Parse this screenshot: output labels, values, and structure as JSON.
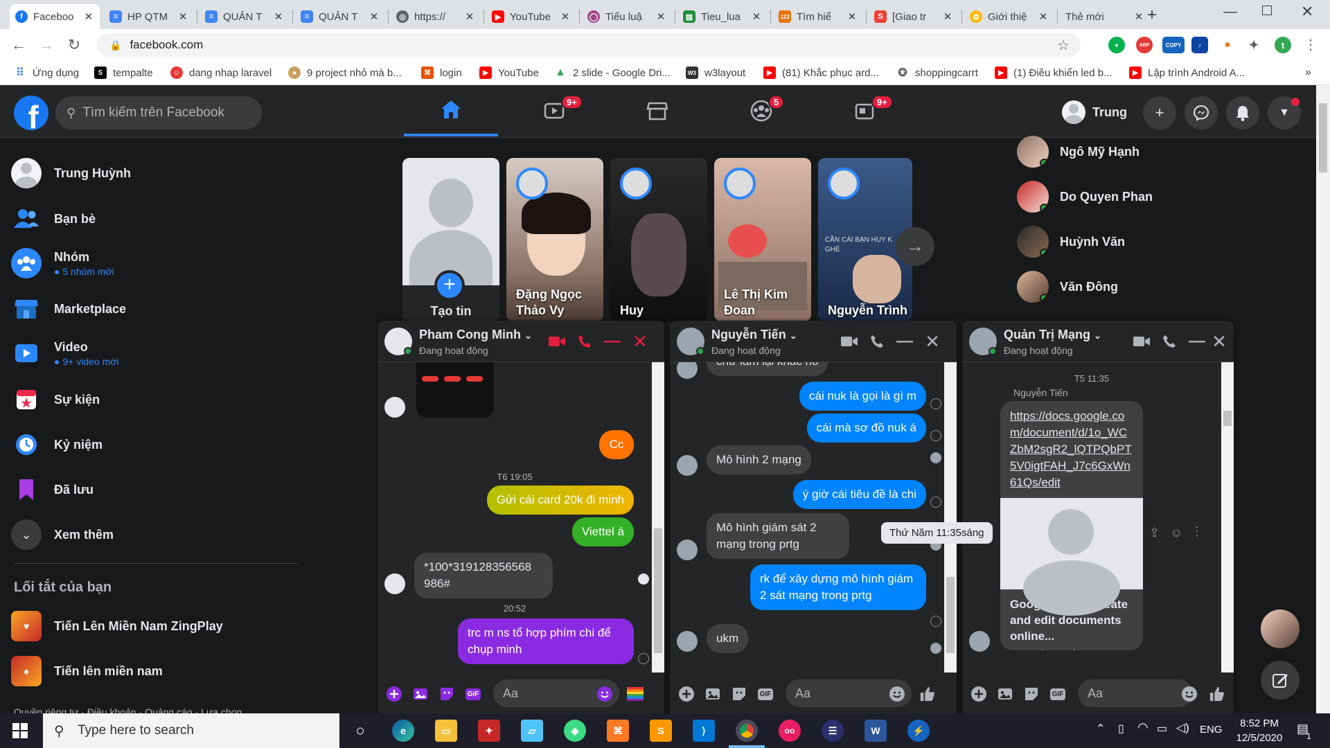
{
  "browser": {
    "tabs": [
      {
        "label": "Faceboo",
        "color": "#1877f2",
        "glyph": "f"
      },
      {
        "label": "HP QTM",
        "color": "#4285f4",
        "glyph": "≡"
      },
      {
        "label": "QUẢN T",
        "color": "#4285f4",
        "glyph": "≡"
      },
      {
        "label": "QUẢN T",
        "color": "#4285f4",
        "glyph": "≡"
      },
      {
        "label": "https://",
        "color": "#5f6368",
        "glyph": "◎"
      },
      {
        "label": "YouTube",
        "color": "#ff0000",
        "glyph": "▶"
      },
      {
        "label": "Tiểu luậ",
        "color": "#a0478a",
        "glyph": "◯"
      },
      {
        "label": "Tieu_lua",
        "color": "#1e8e3e",
        "glyph": "▤"
      },
      {
        "label": "Tìm hiể",
        "color": "#e8710a",
        "glyph": "123"
      },
      {
        "label": "[Giao tr",
        "color": "#ea4335",
        "glyph": "S"
      },
      {
        "label": "Giới thiệ",
        "color": "#fbbc04",
        "glyph": "✿"
      },
      {
        "label": "Thẻ mới",
        "color": "",
        "glyph": ""
      }
    ],
    "url": "facebook.com",
    "bookmarks": [
      {
        "label": "Ứng dụng",
        "color": "#4285f4",
        "glyph": "⠿"
      },
      {
        "label": "tempalte",
        "color": "#000000",
        "glyph": "S"
      },
      {
        "label": "dang nhap laravel",
        "color": "#e53935",
        "glyph": "☺"
      },
      {
        "label": "9 project nhỏ mà b...",
        "color": "#c8a060",
        "glyph": "●"
      },
      {
        "label": "login",
        "color": "#e65100",
        "glyph": "⌘"
      },
      {
        "label": "YouTube",
        "color": "#ff0000",
        "glyph": "▶"
      },
      {
        "label": "2 slide - Google Dri...",
        "color": "#34a853",
        "glyph": "▲"
      },
      {
        "label": "w3layout",
        "color": "#333333",
        "glyph": "W3"
      },
      {
        "label": "(81) Khắc phục ard...",
        "color": "#ff0000",
        "glyph": "▶"
      },
      {
        "label": "shoppingcarrt",
        "color": "#666666",
        "glyph": "✪"
      },
      {
        "label": "(1) Điều khiển led b...",
        "color": "#ff0000",
        "glyph": "▶"
      },
      {
        "label": "Lập trình Android A...",
        "color": "#ff0000",
        "glyph": "▶"
      }
    ],
    "ext_copy": "COPY",
    "ext_abp": "ABP",
    "profile_initial": "t"
  },
  "fb": {
    "search_placeholder": "Tìm kiếm trên Facebook",
    "badges": {
      "watch": "9+",
      "groups": "5",
      "gaming": "9+"
    },
    "user_name": "Trung",
    "sidebar": [
      {
        "label": "Trung Huỳnh",
        "sub": ""
      },
      {
        "label": "Bạn bè",
        "sub": ""
      },
      {
        "label": "Nhóm",
        "sub": "5 nhóm mới"
      },
      {
        "label": "Marketplace",
        "sub": ""
      },
      {
        "label": "Video",
        "sub": "9+ video mới"
      },
      {
        "label": "Sự kiện",
        "sub": ""
      },
      {
        "label": "Kỷ niệm",
        "sub": ""
      },
      {
        "label": "Đã lưu",
        "sub": ""
      },
      {
        "label": "Xem thêm",
        "sub": ""
      }
    ],
    "shortcuts_title": "Lối tắt của bạn",
    "shortcuts": [
      "Tiến Lên Miền Nam ZingPlay",
      "Tiến lên miền nam"
    ],
    "footer": "Quyền riêng tư · Điều khoản · Quảng cáo · Lựa chọn",
    "stories": [
      {
        "name": "Tạo tin"
      },
      {
        "name": "Đặng Ngọc Thảo Vy"
      },
      {
        "name": "Huy"
      },
      {
        "name": "Lê Thị Kim Đoan"
      },
      {
        "name": "Nguyễn Trình"
      }
    ],
    "story_overlay_text": "CẦN CÁI BẠN HUY K GHÉ",
    "contacts": [
      "Ngô Mỹ Hạnh",
      "Do Quyen Phan",
      "Huỳnh Văn",
      "Văn Đông"
    ]
  },
  "chats": [
    {
      "name": "Pham Cong Minh",
      "status": "Đang hoạt động",
      "messages": [
        {
          "text": "Cc",
          "dir": "out"
        },
        {
          "text": "T6 19:05",
          "dir": "time"
        },
        {
          "text": "Gửi cái card 20k đi minh",
          "dir": "out"
        },
        {
          "text": "Viettel á",
          "dir": "out"
        },
        {
          "text": "*100*319128356568 986#",
          "dir": "in"
        },
        {
          "text": "20:52",
          "dir": "time"
        },
        {
          "text": "trc m ns tổ hợp phím chi để chụp minh",
          "dir": "out"
        }
      ],
      "placeholder": "Aa"
    },
    {
      "name": "Nguyễn Tiến",
      "status": "Đang hoạt động",
      "messages": [
        {
          "text": "chứ làm lại khác nó",
          "dir": "in"
        },
        {
          "text": "cái nuk là gọi là gì m",
          "dir": "out"
        },
        {
          "text": "cái mà sơ đồ nuk á",
          "dir": "out"
        },
        {
          "text": "Mô hình 2 mạng",
          "dir": "in"
        },
        {
          "text": "ý giờ cái tiêu đề là chi",
          "dir": "out"
        },
        {
          "text": "Mô hình giám sát 2 mạng trong prtg",
          "dir": "in"
        },
        {
          "text": "rk để xây dựng mô hình giám 2  sát mạng trong prtg",
          "dir": "out"
        },
        {
          "text": "ukm",
          "dir": "in"
        }
      ],
      "placeholder": "Aa"
    },
    {
      "name": "Quản Trị Mạng",
      "status": "Đang hoạt động",
      "time": "T5 11:35",
      "sender": "Nguyễn Tiến",
      "link": "https://docs.google.com/document/d/1o_WCZbM2sgR2_lQTPQbPT5V0igtFAH_J7c6GxWn61Qs/edit",
      "card_title": "Google Docs - create and edit documents online...",
      "card_domain": "accounts.google.com",
      "placeholder": "Aa"
    }
  ],
  "tooltip": "Thứ Năm 11:35sáng",
  "taskbar": {
    "search_placeholder": "Type here to search",
    "lang": "ENG",
    "time": "8:52 PM",
    "date": "12/5/2020",
    "notif_count": "1"
  }
}
